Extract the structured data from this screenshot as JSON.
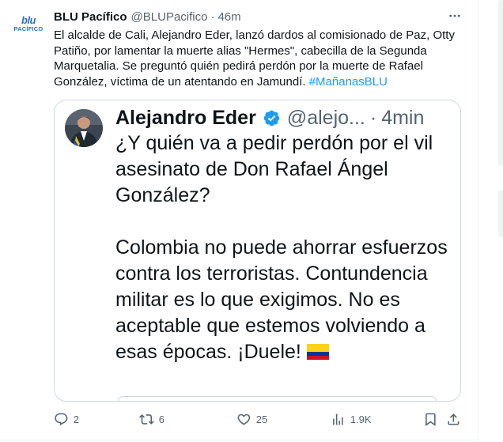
{
  "post": {
    "author": {
      "display_name": "BLU Pacífico",
      "handle": "@BLUPacifico",
      "time": "46m",
      "avatar_logo_top": "blu",
      "avatar_logo_bottom": "PACÍFICO"
    },
    "text": "El alcalde de Cali, Alejandro Eder, lanzó dardos al comisionado de Paz, Otty Patiño, por lamentar la muerte alias \"Hermes\", cabecilla de la Segunda Marquetalia. Se preguntó quién pedirá perdón por la muerte de Rafael González, víctima de un atentando en Jamundí. ",
    "hashtag": "#MañanasBLU",
    "more_icon": "more-horizontal-icon",
    "quote": {
      "display_name": "Alejandro Eder",
      "verified_icon": "verified-badge-icon",
      "handle": "@alejo...",
      "time": "4min",
      "text": "¿Y quién va a pedir perdón por el vil asesinato de Don Rafael Ángel González?\n\nColombia no puede ahorrar esfuerzos contra los terroristas. Contundencia militar es lo que exigimos. No es aceptable que estemos volviendo a esas épocas. ¡Duele! ",
      "flag_emoji": "colombia-flag-icon"
    },
    "actions": {
      "replies": "2",
      "reposts": "6",
      "likes": "25",
      "views": "1.9K"
    }
  },
  "colors": {
    "accent": "#1d9bf0",
    "text": "#0f1419",
    "muted": "#536471",
    "border": "#cfd9de",
    "brand_logo": "#2e6ec2"
  }
}
